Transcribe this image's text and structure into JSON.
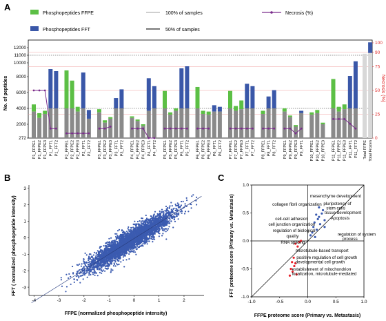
{
  "panels": {
    "a": "A",
    "b": "B",
    "c": "C"
  },
  "colors": {
    "fpe": "#5cbf45",
    "fft": "#3a57a8",
    "total": "#d8d8d8",
    "gray": "#8a8a8a",
    "necrosis": "#7a2c8c",
    "red": "#e8212a",
    "scatter": "#3b5bb0"
  },
  "chart_data": [
    {
      "type": "bar",
      "legend": {
        "fpe": "Phosphopeptides FFPE",
        "fft": "Phosphopeptides FFT",
        "all": "100% of samples",
        "half": "50% of samples",
        "necrosis": "Necrosis (%)"
      },
      "ylabel": "No. of peptides",
      "right_ylabel": "Necrosis (%)",
      "y_ticks": [
        272,
        2000,
        4000,
        6000,
        8000,
        10000,
        11000,
        12000
      ],
      "right_ticks": [
        0,
        25,
        50,
        75,
        90,
        100
      ],
      "lines": {
        "all_samples": 11000,
        "half_samples": 4000
      },
      "groups": [
        {
          "name": "P1",
          "samples": [
            {
              "label": "P1_FFPE1",
              "value": 4500,
              "gray": 3600,
              "kind": "fpe",
              "necrosis": 50
            },
            {
              "label": "P1_FFPE2",
              "value": 3400,
              "gray": 2800,
              "kind": "fpe",
              "necrosis": 50
            },
            {
              "label": "P1_FFPE3",
              "value": 3700,
              "gray": 3300,
              "kind": "fpe",
              "necrosis": 50
            },
            {
              "label": "P1_FFT1",
              "value": 9100,
              "gray": 4000,
              "kind": "fft",
              "necrosis": 10
            },
            {
              "label": "P1_FFT2",
              "value": 8800,
              "gray": 4000,
              "kind": "fft",
              "necrosis": 10
            }
          ]
        },
        {
          "name": "P2",
          "samples": [
            {
              "label": "P2_FFPE1",
              "value": 8900,
              "gray": 4000,
              "kind": "fpe",
              "necrosis": 5
            },
            {
              "label": "P2_FFPE2",
              "value": 7500,
              "gray": 4000,
              "kind": "fpe",
              "necrosis": 5
            },
            {
              "label": "P2_FFPE3",
              "value": 4200,
              "gray": 3600,
              "kind": "fpe",
              "necrosis": 5
            },
            {
              "label": "P2_FFT1",
              "value": 8600,
              "gray": 4000,
              "kind": "fft",
              "necrosis": 5
            },
            {
              "label": "P2_FFT2",
              "value": 3800,
              "gray": 2700,
              "kind": "fft",
              "necrosis": 5
            }
          ]
        },
        {
          "name": "P3",
          "samples": [
            {
              "label": "P3_FFPE1",
              "value": 3900,
              "gray": 3500,
              "kind": "fpe",
              "necrosis": 10
            },
            {
              "label": "P3_FFPE2",
              "value": 2500,
              "gray": 2200,
              "kind": "fpe",
              "necrosis": 10
            },
            {
              "label": "P3_FFPE3",
              "value": 2900,
              "gray": 2700,
              "kind": "fpe",
              "necrosis": 12
            },
            {
              "label": "P3_FFT1",
              "value": 5300,
              "gray": 4000,
              "kind": "fft",
              "necrosis": null
            },
            {
              "label": "P3_FFT2",
              "value": 6400,
              "gray": 4000,
              "kind": "fft",
              "necrosis": null
            }
          ]
        },
        {
          "name": "P4",
          "samples": [
            {
              "label": "P4_FFPE1",
              "value": 3000,
              "gray": 2800,
              "kind": "fpe",
              "necrosis": 10
            },
            {
              "label": "P4_FFPE2",
              "value": 2600,
              "gray": 2400,
              "kind": "fpe",
              "necrosis": 10
            },
            {
              "label": "P4_FFPE3",
              "value": 2000,
              "gray": 1800,
              "kind": "fpe",
              "necrosis": 10
            },
            {
              "label": "P4_FFT1",
              "value": 7800,
              "gray": 3700,
              "kind": "fft",
              "necrosis": 0
            },
            {
              "label": "P4_FFT2",
              "value": 6800,
              "gray": 4000,
              "kind": "fft",
              "necrosis": 0
            }
          ]
        },
        {
          "name": "P5",
          "samples": [
            {
              "label": "P5_FFPE1",
              "value": 6200,
              "gray": 4000,
              "kind": "fpe",
              "necrosis": 10
            },
            {
              "label": "P5_FFPE2",
              "value": 3500,
              "gray": 3200,
              "kind": "fpe",
              "necrosis": 10
            },
            {
              "label": "P5_FFPE3",
              "value": 4000,
              "gray": 3700,
              "kind": "fpe",
              "necrosis": 10
            },
            {
              "label": "P5_FFT1",
              "value": 9200,
              "gray": 4000,
              "kind": "fft",
              "necrosis": 10
            },
            {
              "label": "P5_FFT2",
              "value": 9500,
              "gray": 4000,
              "kind": "fft",
              "necrosis": 10
            }
          ]
        },
        {
          "name": "P6",
          "samples": [
            {
              "label": "P6_FFPE1",
              "value": 6700,
              "gray": 4000,
              "kind": "fpe",
              "necrosis": 10
            },
            {
              "label": "P6_FFPE2",
              "value": 3700,
              "gray": 3300,
              "kind": "fpe",
              "necrosis": 10
            },
            {
              "label": "P6_FFPE3",
              "value": 3600,
              "gray": 3200,
              "kind": "fpe",
              "necrosis": 10
            },
            {
              "label": "P6_FFT1",
              "value": 4400,
              "gray": 3600,
              "kind": "fft",
              "necrosis": null
            },
            {
              "label": "P6_FFT2",
              "value": 4200,
              "gray": 3600,
              "kind": "fft",
              "necrosis": null
            }
          ]
        },
        {
          "name": "P7",
          "samples": [
            {
              "label": "P7_FFPE1",
              "value": 6200,
              "gray": 4000,
              "kind": "fpe",
              "necrosis": 10
            },
            {
              "label": "P7_FFPE2",
              "value": 4300,
              "gray": 3700,
              "kind": "fpe",
              "necrosis": 10
            },
            {
              "label": "P7_FFPE3",
              "value": 5000,
              "gray": 3900,
              "kind": "fpe",
              "necrosis": 10
            },
            {
              "label": "P7_FFT1",
              "value": 7100,
              "gray": 4000,
              "kind": "fft",
              "necrosis": 10
            },
            {
              "label": "P7_FFT2",
              "value": 6800,
              "gray": 4000,
              "kind": "fft",
              "necrosis": 10
            }
          ]
        },
        {
          "name": "P8",
          "samples": [
            {
              "label": "P8_FFPE1",
              "value": 3700,
              "gray": 3300,
              "kind": "fpe",
              "necrosis": 10
            },
            {
              "label": "P8_FFT1",
              "value": 5500,
              "gray": 4000,
              "kind": "fft",
              "necrosis": 10
            },
            {
              "label": "P8_FFT2",
              "value": 6300,
              "gray": 4000,
              "kind": "fft",
              "necrosis": 10
            }
          ]
        },
        {
          "name": "P9",
          "samples": [
            {
              "label": "P9_FFPE1",
              "value": 4000,
              "gray": 3600,
              "kind": "fpe",
              "necrosis": 10
            },
            {
              "label": "P9_FFPE2",
              "value": 3100,
              "gray": 2900,
              "kind": "fpe",
              "necrosis": 10
            },
            {
              "label": "P9_FFPE3",
              "value": 1900,
              "gray": 1700,
              "kind": "fpe",
              "necrosis": 5
            },
            {
              "label": "P9_FFT1",
              "value": 3700,
              "gray": 3400,
              "kind": "fft",
              "necrosis": 10
            }
          ]
        },
        {
          "name": "P10",
          "samples": [
            {
              "label": "P10_FFPE1",
              "value": 3500,
              "gray": 3200,
              "kind": "fpe",
              "necrosis": null
            },
            {
              "label": "P10_FFPE2",
              "value": 3800,
              "gray": 3400,
              "kind": "fpe",
              "necrosis": null
            },
            {
              "label": "P10_FFPE3",
              "value": 2200,
              "gray": 2000,
              "kind": "fpe",
              "necrosis": null
            }
          ]
        },
        {
          "name": "P11",
          "samples": [
            {
              "label": "P11_FFPE1",
              "value": 7700,
              "gray": 4000,
              "kind": "fpe",
              "necrosis": 20
            },
            {
              "label": "P11_FFPE2",
              "value": 4200,
              "gray": 3600,
              "kind": "fpe",
              "necrosis": 20
            },
            {
              "label": "P11_FFPE3",
              "value": 4500,
              "gray": 3900,
              "kind": "fpe",
              "necrosis": 20
            },
            {
              "label": "P11_FFT1",
              "value": 8100,
              "gray": 4000,
              "kind": "fft",
              "necrosis": 15
            },
            {
              "label": "P11_FFT2",
              "value": 10200,
              "gray": 4000,
              "kind": "fft",
              "necrosis": 10
            }
          ]
        },
        {
          "name": "Total",
          "samples": [
            {
              "label": "Total FFPE",
              "value": 11200,
              "gray": 11200,
              "kind": "total",
              "necrosis": null
            },
            {
              "label": "Total Frozen",
              "value": 12700,
              "gray": 11300,
              "kind": "total",
              "necrosis": null
            }
          ]
        }
      ]
    },
    {
      "type": "scatter",
      "xlabel": "FFPE (normalized phosphopeptide intensity)",
      "ylabel": "FFT ( normalized phosphopeptide intensity)",
      "xlim": [
        -4.2,
        2.8
      ],
      "ylim": [
        -3.5,
        3.2
      ],
      "x_ticks": [
        -4,
        -3,
        -2,
        -1,
        0,
        1,
        2
      ],
      "y_ticks": [
        -3,
        -2,
        -1,
        0,
        1,
        2,
        3
      ],
      "n_points": 3800,
      "fit": {
        "slope": 0.95,
        "intercept": -0.05
      }
    },
    {
      "type": "scatter",
      "xlabel": "FFPE proteome score (Primary vs. Metastasis)",
      "ylabel": "FFT proteome score (Primary vs. Metastasis)",
      "xlim": [
        -1.0,
        1.0
      ],
      "ylim": [
        -1.0,
        1.0
      ],
      "x_ticks": [
        -1.0,
        -0.5,
        0.0,
        0.5,
        1.0
      ],
      "y_ticks": [
        -1.0,
        -0.5,
        0.0,
        0.5,
        1.0
      ],
      "blue_points": [
        {
          "x": 0.2,
          "y": 0.6
        },
        {
          "x": 0.27,
          "y": 0.55
        },
        {
          "x": 0.25,
          "y": 0.49
        },
        {
          "x": 0.15,
          "y": 0.47
        },
        {
          "x": 0.2,
          "y": 0.43
        },
        {
          "x": 0.18,
          "y": 0.39
        },
        {
          "x": 0.3,
          "y": 0.37
        },
        {
          "x": 0.12,
          "y": 0.33
        },
        {
          "x": 0.22,
          "y": 0.3
        },
        {
          "x": 0.1,
          "y": 0.25
        },
        {
          "x": 0.16,
          "y": 0.2
        },
        {
          "x": 0.08,
          "y": 0.15
        },
        {
          "x": 0.05,
          "y": 0.1
        },
        {
          "x": 0.13,
          "y": 0.07
        },
        {
          "x": 0.3,
          "y": 0.25
        }
      ],
      "red_points": [
        {
          "x": -0.22,
          "y": -0.05
        },
        {
          "x": -0.15,
          "y": -0.02
        },
        {
          "x": -0.18,
          "y": -0.1
        },
        {
          "x": -0.25,
          "y": -0.3
        },
        {
          "x": -0.28,
          "y": -0.38
        },
        {
          "x": -0.24,
          "y": -0.45
        },
        {
          "x": -0.3,
          "y": -0.5
        },
        {
          "x": -0.27,
          "y": -0.55
        },
        {
          "x": -0.2,
          "y": -0.6
        },
        {
          "x": -0.32,
          "y": -0.62
        },
        {
          "x": -0.22,
          "y": -0.4
        },
        {
          "x": -0.12,
          "y": 0.0
        }
      ],
      "annotations": [
        {
          "text": "mesenchyme development",
          "x": 0.04,
          "y": 0.78,
          "color": "#000"
        },
        {
          "text": "collagen fibril organization",
          "x": -0.63,
          "y": 0.63,
          "color": "#000"
        },
        {
          "text": "pluripotency of",
          "x": 0.28,
          "y": 0.64,
          "color": "#000"
        },
        {
          "text": "stem cells",
          "x": 0.33,
          "y": 0.56,
          "color": "#000"
        },
        {
          "text": "tissue development",
          "x": 0.3,
          "y": 0.48,
          "color": "#000"
        },
        {
          "text": "Apoptosis",
          "x": 0.41,
          "y": 0.38,
          "color": "#000"
        },
        {
          "text": "cell-cell adhesion",
          "x": -0.58,
          "y": 0.37,
          "color": "#000"
        },
        {
          "text": "cell junction organization",
          "x": -0.7,
          "y": 0.27,
          "color": "#000"
        },
        {
          "text": "regulation of biological",
          "x": -0.62,
          "y": 0.16,
          "color": "#000"
        },
        {
          "text": "quality",
          "x": -0.38,
          "y": 0.06,
          "color": "#000"
        },
        {
          "text": "regulation of system",
          "x": 0.53,
          "y": 0.09,
          "color": "#000"
        },
        {
          "text": "process",
          "x": 0.62,
          "y": 0.01,
          "color": "#000"
        },
        {
          "text": "RNA splicing",
          "x": -0.48,
          "y": -0.05,
          "color": "#000"
        },
        {
          "text": "microtubule-based transport",
          "x": -0.22,
          "y": -0.2,
          "color": "#000"
        },
        {
          "text": "positive regulation of cell growth",
          "x": -0.2,
          "y": -0.32,
          "color": "#000"
        },
        {
          "text": "developmental cell growth",
          "x": -0.22,
          "y": -0.4,
          "color": "#000"
        },
        {
          "text": "establishment of mitochondrion",
          "x": -0.28,
          "y": -0.53,
          "color": "#000"
        },
        {
          "text": "localization, microtubule-mediated",
          "x": -0.28,
          "y": -0.61,
          "color": "#000"
        }
      ]
    }
  ]
}
